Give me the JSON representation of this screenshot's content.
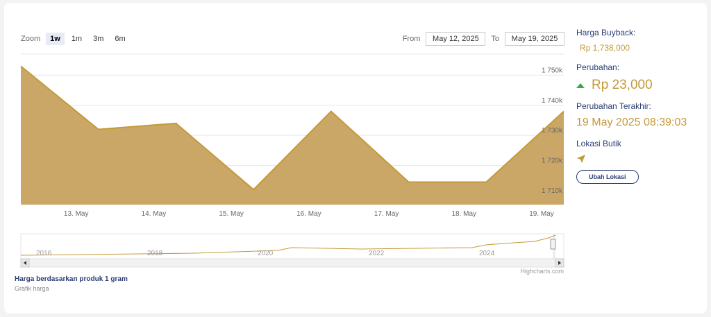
{
  "zoom": {
    "label": "Zoom",
    "buttons": [
      "1w",
      "1m",
      "3m",
      "6m"
    ],
    "active": "1w"
  },
  "range": {
    "from_label": "From",
    "from_value": "May 12, 2025",
    "to_label": "To",
    "to_value": "May 19, 2025"
  },
  "chart_data": {
    "type": "area",
    "x": [
      "12. May",
      "13. May",
      "14. May",
      "15. May",
      "16. May",
      "17. May",
      "18. May",
      "19. May"
    ],
    "x_labels": [
      "13. May",
      "14. May",
      "15. May",
      "16. May",
      "17. May",
      "18. May",
      "19. May"
    ],
    "values": [
      1753000,
      1732000,
      1734000,
      1712000,
      1738000,
      1714500,
      1714500,
      1738000
    ],
    "ylim": [
      1707000,
      1757000
    ],
    "y_ticks": [
      1710000,
      1720000,
      1730000,
      1740000,
      1750000
    ],
    "y_tick_labels": [
      "1 710k",
      "1 720k",
      "1 730k",
      "1 740k",
      "1 750k"
    ],
    "grid": true,
    "color": "#c49a3a",
    "fill": "#caa766",
    "navigator": {
      "years": [
        "2016",
        "2018",
        "2020",
        "2022",
        "2024"
      ],
      "credit": "Highcharts.com"
    }
  },
  "panel": {
    "buyback_label": "Harga Buyback:",
    "buyback_value": "Rp 1,738,000",
    "change_label": "Perubahan:",
    "change_value": "Rp 23,000",
    "last_change_label": "Perubahan Terakhir:",
    "last_change_value": "19 May 2025 08:39:03",
    "location_label": "Lokasi Butik",
    "change_location_button": "Ubah Lokasi"
  },
  "caption": {
    "title": "Harga berdasarkan produk 1 gram",
    "subtitle": "Grafik harga"
  }
}
